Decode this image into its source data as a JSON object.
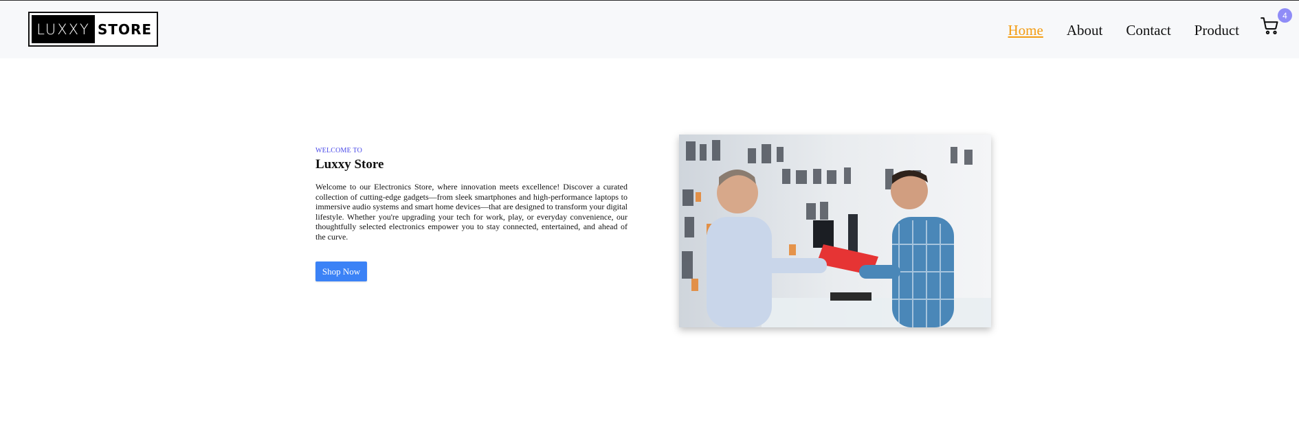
{
  "brand": {
    "logo_left": "LUXXY",
    "logo_right": "STORE"
  },
  "nav": {
    "items": [
      {
        "label": "Home",
        "active": true
      },
      {
        "label": "About",
        "active": false
      },
      {
        "label": "Contact",
        "active": false
      },
      {
        "label": "Product",
        "active": false
      }
    ],
    "cart_icon": "cart-icon",
    "cart_count": "4"
  },
  "hero": {
    "eyebrow": "WELCOME TO",
    "title": "Luxxy Store",
    "description": "Welcome to our Electronics Store, where innovation meets excellence! Discover a curated collection of cutting-edge gadgets—from sleek smartphones and high-performance laptops to immersive audio systems and smart home devices—that are designed to transform your digital lifestyle. Whether you're upgrading your tech for work, play, or everyday convenience, our thoughtfully selected electronics empower you to stay connected, entertained, and ahead of the curve.",
    "cta_label": "Shop Now"
  },
  "colors": {
    "nav_active": "#f39c12",
    "eyebrow": "#4a4ae8",
    "cta_bg": "#3b82f6",
    "badge_bg": "#8f8cf7",
    "header_bg": "#f7f8fa"
  }
}
